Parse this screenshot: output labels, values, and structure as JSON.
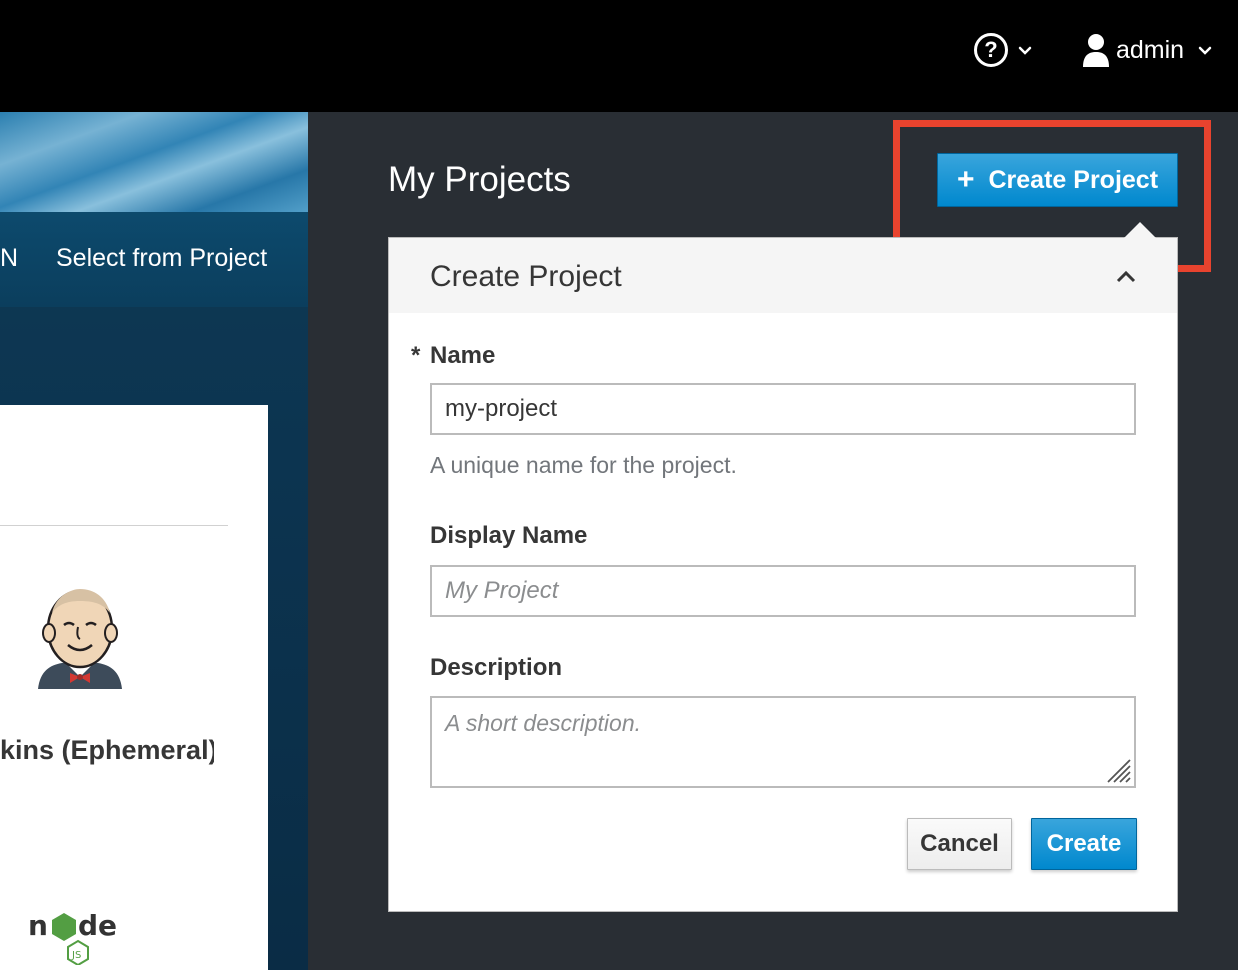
{
  "header": {
    "help_icon_glyph": "?",
    "user_name": "admin"
  },
  "left_panel": {
    "tab_fragment": "N",
    "tab_select": "Select from Project",
    "catalog_item_title": "kins (Ephemeral)"
  },
  "main": {
    "title": "My Projects",
    "create_button_label": "Create Project",
    "create_button_icon": "+"
  },
  "popover": {
    "title": "Create Project",
    "required_mark": "*",
    "name_label": "Name",
    "name_value": "my-project",
    "name_help": "A unique name for the project.",
    "display_name_label": "Display Name",
    "display_name_placeholder": "My Project",
    "description_label": "Description",
    "description_placeholder": "A short description.",
    "cancel_label": "Cancel",
    "create_label": "Create"
  },
  "colors": {
    "primary": "#0088ce",
    "highlight": "#e8432e",
    "page_bg": "#292e34",
    "header_bg": "#000000"
  }
}
